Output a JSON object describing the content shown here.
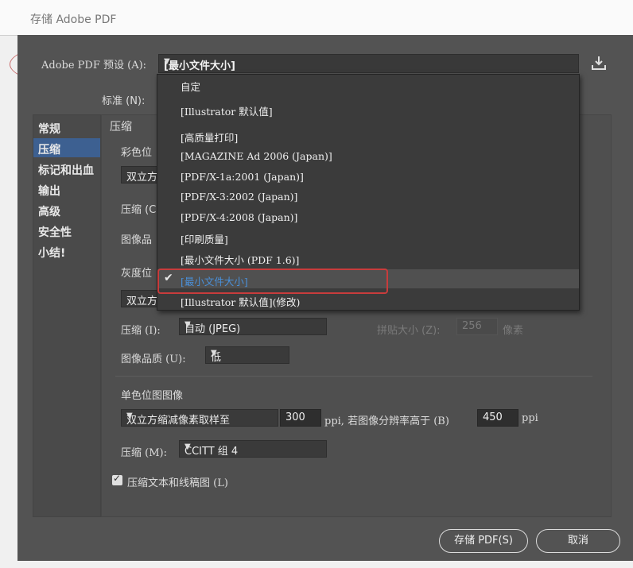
{
  "window": {
    "title": "存储 Adobe PDF"
  },
  "preset": {
    "label": "Adobe PDF 预设 (A):",
    "value": "[最小文件大小]"
  },
  "standard": {
    "label": "标准 (N):"
  },
  "sidebar": {
    "items": [
      "常规",
      "压缩",
      "标记和出血",
      "输出",
      "高级",
      "安全性",
      "小结!"
    ],
    "selected": "压缩"
  },
  "compression": {
    "section_title": "压缩",
    "color": {
      "title": "彩色位",
      "sample": "双立方",
      "compress_label": "压缩 (C",
      "quality_label": "图像品"
    },
    "gray": {
      "title": "灰度位",
      "sample": "双立方",
      "compress_label": "压缩 (I):",
      "compress_value": "自动 (JPEG)",
      "tile_label": "拼贴大小 (Z):",
      "tile_value": "256",
      "tile_unit": "像素",
      "quality_label": "图像品质 (U):",
      "quality_value": "低"
    },
    "mono": {
      "title": "单色位图图像",
      "sample": "双立方缩减像素取样至",
      "ppi": "300",
      "ppi_text": "ppi, 若图像分辨率高于 (B)",
      "above_ppi": "450",
      "ppi_unit": "ppi",
      "compress_label": "压缩 (M):",
      "compress_value": "CCITT 组 4"
    },
    "text_art": {
      "label": "压缩文本和线稿图 (L)",
      "checked": true
    }
  },
  "menu": {
    "items": [
      "自定",
      "[Illustrator 默认值]",
      "[高质量打印]",
      "[MAGAZINE Ad 2006 (Japan)]",
      "[PDF/X-1a:2001 (Japan)]",
      "[PDF/X-3:2002 (Japan)]",
      "[PDF/X-4:2008 (Japan)]",
      "[印刷质量]",
      "[最小文件大小 (PDF 1.6)]",
      "[最小文件大小]",
      "[Illustrator 默认值](修改)"
    ],
    "selected": "[最小文件大小]"
  },
  "buttons": {
    "save": "存储 PDF(S)",
    "cancel": "取消"
  },
  "colors": {
    "dialog_bg": "#535353",
    "highlight": "#3d6091",
    "annotation_red": "#c83c3c",
    "selected_text": "#4a90d9"
  }
}
